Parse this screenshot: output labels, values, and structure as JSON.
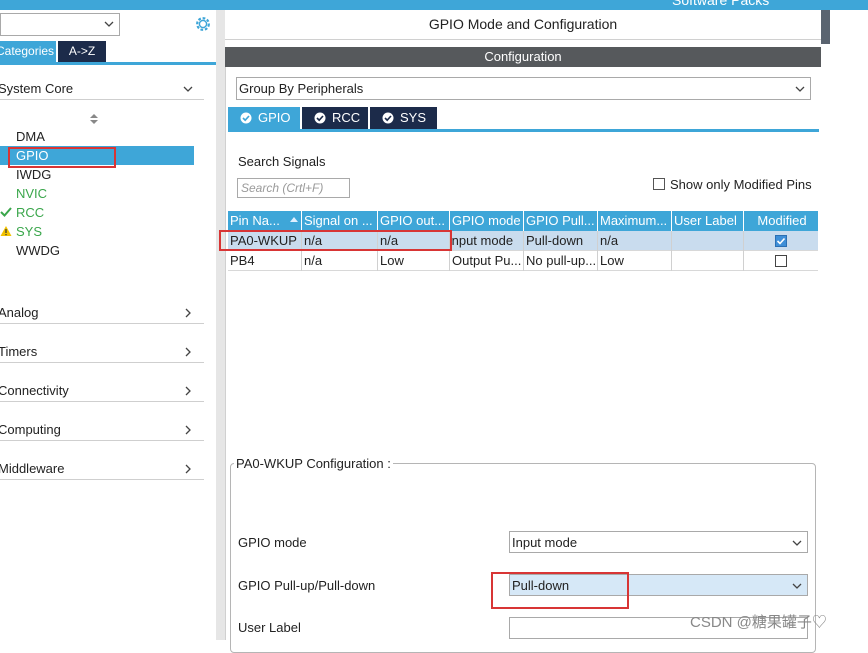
{
  "top_strip": {
    "text": "Software Packs"
  },
  "left": {
    "tabs": {
      "categories": "Categories",
      "az": "A->Z"
    },
    "system_core": "System Core",
    "core_items": [
      {
        "label": "DMA",
        "status": "none"
      },
      {
        "label": "GPIO",
        "status": "none"
      },
      {
        "label": "IWDG",
        "status": "none"
      },
      {
        "label": "NVIC",
        "status": "none"
      },
      {
        "label": "RCC",
        "status": "ok"
      },
      {
        "label": "SYS",
        "status": "warning"
      },
      {
        "label": "WWDG",
        "status": "none"
      }
    ],
    "categories": [
      "Analog",
      "Timers",
      "Connectivity",
      "Computing",
      "Middleware"
    ]
  },
  "main": {
    "title": "GPIO Mode and Configuration",
    "config_header": "Configuration",
    "group_by": "Group By Peripherals",
    "tabs": [
      "GPIO",
      "RCC",
      "SYS"
    ],
    "search_label": "Search Signals",
    "search_placeholder": "Search (Crtl+F)",
    "show_modified": "Show only Modified Pins",
    "table": {
      "headers": [
        "Pin Na...",
        "Signal on ...",
        "GPIO out...",
        "GPIO mode",
        "GPIO Pull...",
        "Maximum...",
        "User Label",
        "Modified"
      ],
      "rows": [
        {
          "pin": "PA0-WKUP",
          "signal": "n/a",
          "output": "n/a",
          "mode": "Input mode",
          "pull": "Pull-down",
          "max": "n/a",
          "label": "",
          "modified": true
        },
        {
          "pin": "PB4",
          "signal": "n/a",
          "output": "Low",
          "mode": "Output Pu...",
          "pull": "No pull-up...",
          "max": "Low",
          "label": "",
          "modified": false
        }
      ]
    },
    "pin_config": {
      "legend": "PA0-WKUP Configuration :",
      "gpio_mode_label": "GPIO mode",
      "gpio_mode_value": "Input mode",
      "pull_label": "GPIO Pull-up/Pull-down",
      "pull_value": "Pull-down",
      "user_label_label": "User Label",
      "user_label_value": ""
    }
  },
  "colors": {
    "accent": "#3ea6d8",
    "dark_tab": "#1c2b4a",
    "header_bar": "#56595c",
    "highlight": "#d83535"
  },
  "watermark": "CSDN @糖果罐子♡"
}
